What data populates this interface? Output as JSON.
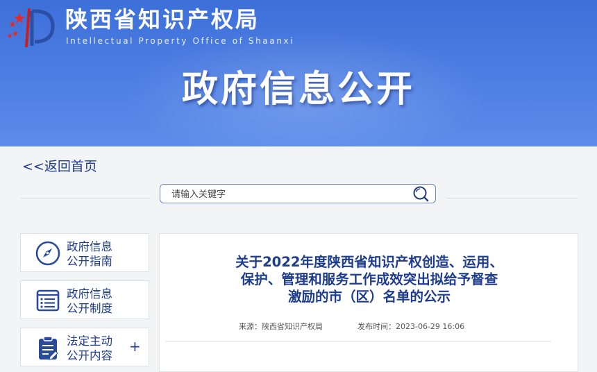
{
  "header": {
    "org_name_cn": "陕西省知识产权局",
    "org_name_en": "Intellectual Property Office of Shaanxi",
    "hero_title": "政府信息公开"
  },
  "nav": {
    "back_link": "<<返回首页"
  },
  "search": {
    "placeholder": "请输入关键字"
  },
  "sidebar": {
    "items": [
      {
        "label_line1": "政府信息",
        "label_line2": "公开指南",
        "icon": "compass-icon"
      },
      {
        "label_line1": "政府信息",
        "label_line2": "公开制度",
        "icon": "document-list-icon"
      },
      {
        "label_line1": "法定主动",
        "label_line2": "公开内容",
        "icon": "clipboard-icon",
        "expand": "+"
      }
    ]
  },
  "article": {
    "title_line1": "关于2022年度陕西省知识产权创造、运用、",
    "title_line2": "保护、管理和服务工作成效突出拟给予督查",
    "title_line3": "激励的市（区）名单的公示",
    "source": "来源：陕西省知识产权局",
    "published": "发布时间：2023-06-29 16:06"
  },
  "colors": {
    "banner": "#4a7be2",
    "link_blue": "#1e3c8c",
    "panel_bg": "#f3f4f6",
    "star_red": "#e02a2a"
  }
}
